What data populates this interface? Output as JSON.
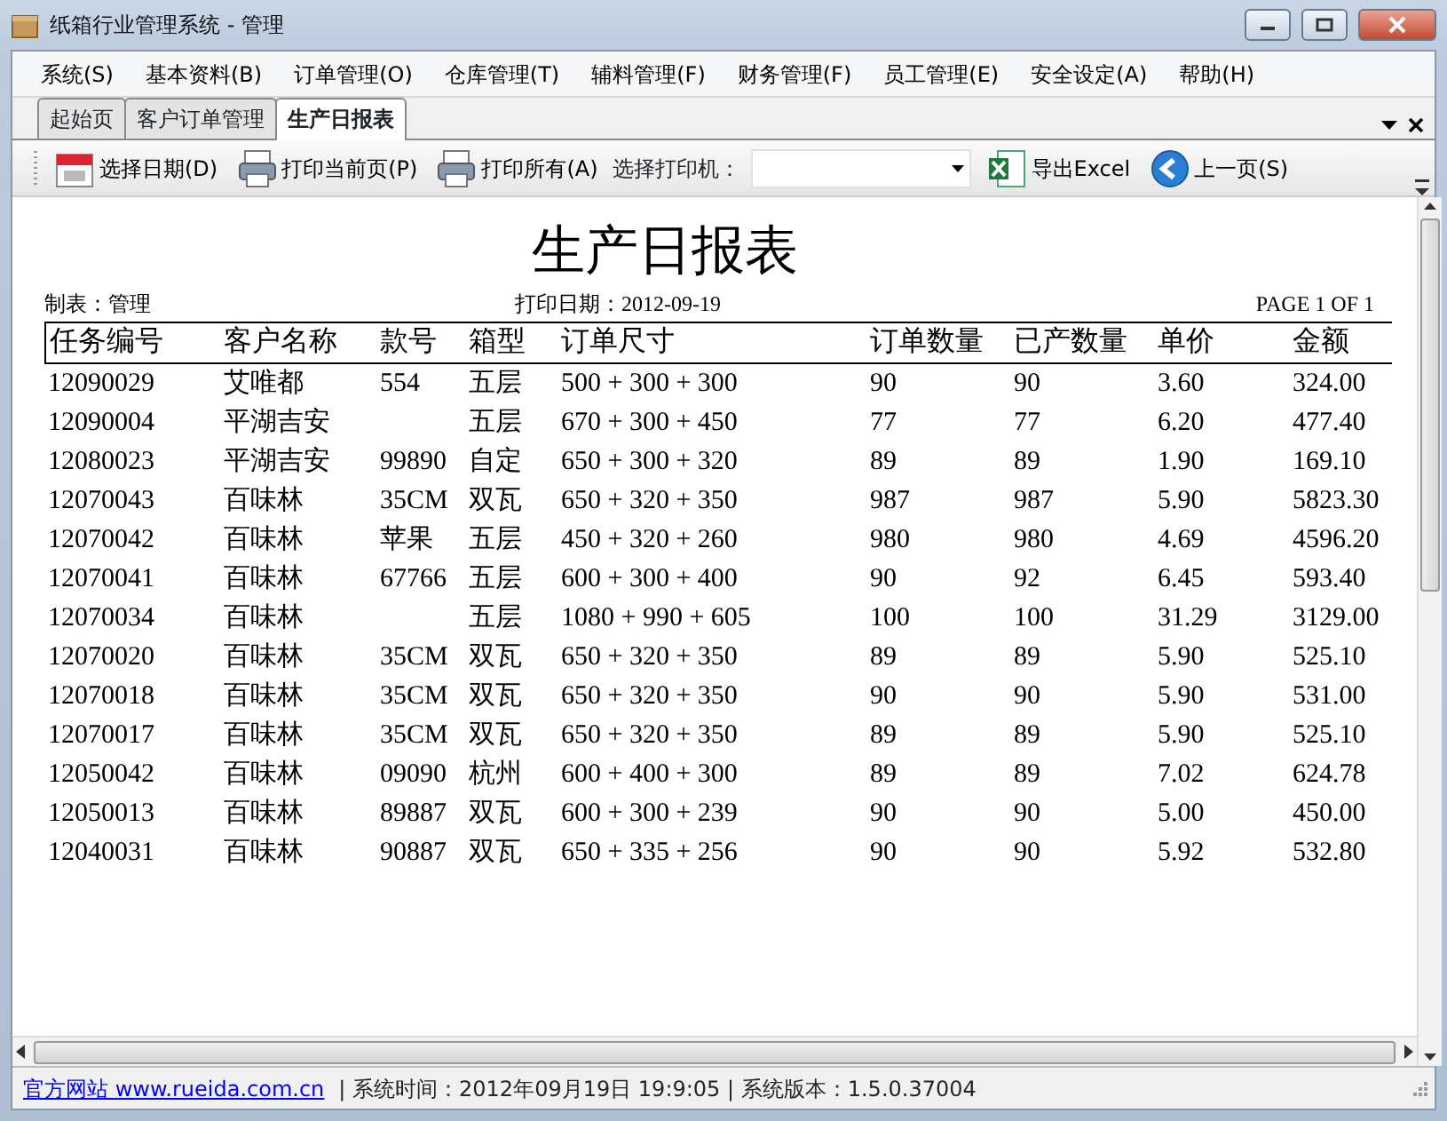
{
  "window": {
    "title": "纸箱行业管理系统 - 管理"
  },
  "menu": [
    "系统(S)",
    "基本资料(B)",
    "订单管理(O)",
    "仓库管理(T)",
    "辅料管理(F)",
    "财务管理(F)",
    "员工管理(E)",
    "安全设定(A)",
    "帮助(H)"
  ],
  "tabs": [
    {
      "label": "起始页",
      "selected": false
    },
    {
      "label": "客户订单管理",
      "selected": false
    },
    {
      "label": "生产日报表",
      "selected": true
    }
  ],
  "toolbar": [
    {
      "kind": "button",
      "label": "选择日期(D)"
    },
    {
      "kind": "button",
      "label": "打印当前页(P)"
    },
    {
      "kind": "button",
      "label": "打印所有(A)"
    },
    {
      "kind": "label",
      "label": "选择打印机："
    },
    {
      "kind": "dropdown"
    },
    {
      "kind": "button",
      "label": "导出Excel"
    },
    {
      "kind": "button",
      "label": "上一页(S)"
    }
  ],
  "report": {
    "title": "生产日报表",
    "maker": "制表：管理",
    "print_date_label": "打印日期：",
    "print_date": "2012-09-19",
    "page": "PAGE 1 OF 1",
    "columns": [
      "任务编号",
      "客户名称",
      "款号",
      "箱型",
      "订单尺寸",
      "订单数量",
      "已产数量",
      "单价",
      "金额"
    ],
    "rows": [
      [
        "12090029",
        "艾唯都",
        "554",
        "五层",
        "500 + 300 + 300",
        "90",
        "90",
        "3.60",
        "324.00"
      ],
      [
        "12090004",
        "平湖吉安",
        null,
        "五层",
        "670 + 300 + 450",
        "77",
        "77",
        "6.20",
        "477.40"
      ],
      [
        "12080023",
        "平湖吉安",
        "99890",
        "自定",
        "650 + 300 + 320",
        "89",
        "89",
        "1.90",
        "169.10"
      ],
      [
        "12070043",
        "百味林",
        "35CM",
        "双瓦",
        "650 + 320 + 350",
        "987",
        "987",
        "5.90",
        "5823.30"
      ],
      [
        "12070042",
        "百味林",
        "苹果",
        "五层",
        "450 + 320 + 260",
        "980",
        "980",
        "4.69",
        "4596.20"
      ],
      [
        "12070041",
        "百味林",
        "67766",
        "五层",
        "600 + 300 + 400",
        "90",
        "92",
        "6.45",
        "593.40"
      ],
      [
        "12070034",
        "百味林",
        null,
        "五层",
        "1080 + 990 + 605",
        "100",
        "100",
        "31.29",
        "3129.00"
      ],
      [
        "12070020",
        "百味林",
        "35CM",
        "双瓦",
        "650 + 320 + 350",
        "89",
        "89",
        "5.90",
        "525.10"
      ],
      [
        "12070018",
        "百味林",
        "35CM",
        "双瓦",
        "650 + 320 + 350",
        "90",
        "90",
        "5.90",
        "531.00"
      ],
      [
        "12070017",
        "百味林",
        "35CM",
        "双瓦",
        "650 + 320 + 350",
        "89",
        "89",
        "5.90",
        "525.10"
      ],
      [
        "12050042",
        "百味林",
        "09090",
        "杭州",
        "600 + 400 + 300",
        "89",
        "89",
        "7.02",
        "624.78"
      ],
      [
        "12050013",
        "百味林",
        "89887",
        "双瓦",
        "600 + 300 + 239",
        "90",
        "90",
        "5.00",
        "450.00"
      ],
      [
        "12040031",
        "百味林",
        "90887",
        "双瓦",
        "650 + 335 + 256",
        "90",
        "90",
        "5.92",
        "532.80"
      ]
    ]
  },
  "status_bar": {
    "link": "官方网站 www.rueida.com.cn",
    "info": "| 系统时间：2012年09月19日 19:9:05 | 系统版本：1.5.0.37004"
  }
}
